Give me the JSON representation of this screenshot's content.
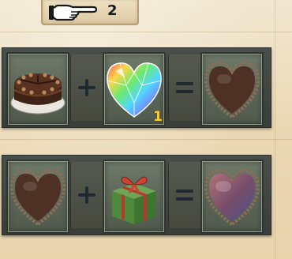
{
  "header": {
    "pointer_icon": "pointing-hand-icon",
    "count": "2"
  },
  "recipes": [
    {
      "ingredient_a": {
        "icon": "chocolate-cake-icon"
      },
      "operator_1": {
        "symbol": "+"
      },
      "ingredient_b": {
        "icon": "rainbow-heart-gem-icon",
        "quantity": "1"
      },
      "operator_2": {
        "symbol": "="
      },
      "result": {
        "icon": "chocolate-heart-icon"
      }
    },
    {
      "ingredient_a": {
        "icon": "chocolate-heart-icon"
      },
      "operator_1": {
        "symbol": "+"
      },
      "ingredient_b": {
        "icon": "gift-box-icon"
      },
      "operator_2": {
        "symbol": "="
      },
      "result": {
        "icon": "glossy-chocolate-heart-icon"
      }
    }
  ],
  "colors": {
    "quantity_text": "#f3d21a",
    "panel_bg": "#3f433e",
    "slot_bg": "#5f6b5c",
    "page_bg": "#ecdcb9"
  }
}
